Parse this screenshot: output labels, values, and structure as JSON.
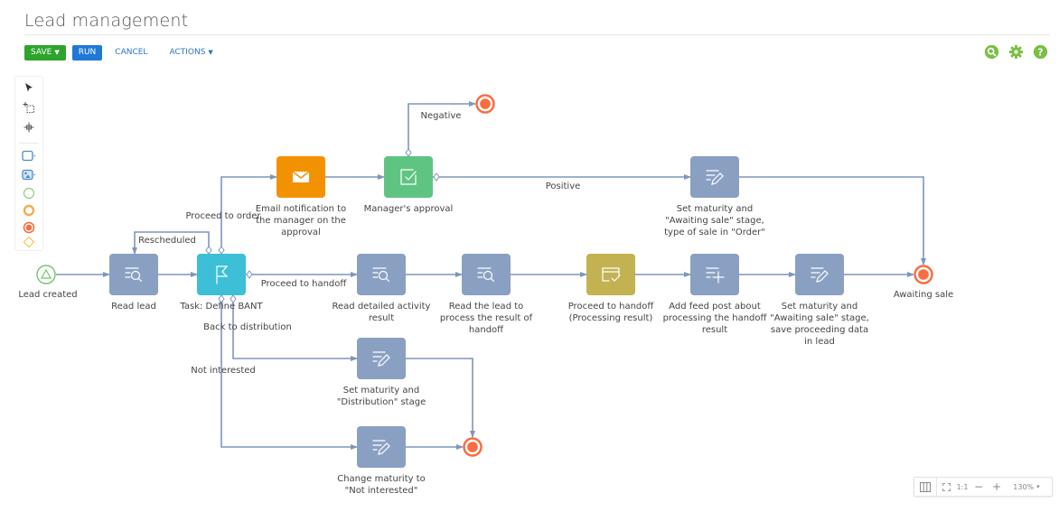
{
  "page": {
    "title": "Lead management"
  },
  "toolbar": {
    "save_label": "SAVE",
    "run_label": "RUN",
    "cancel_label": "CANCEL",
    "actions_label": "ACTIONS",
    "caret": "▼"
  },
  "top_icons": [
    "search-icon",
    "gear-icon",
    "help-icon"
  ],
  "palette": {
    "tools": [
      "pointer-tool",
      "marquee-select-tool",
      "move-tool"
    ],
    "elements": [
      "user-task-element",
      "script-task-element",
      "start-event-element",
      "intermediate-event-element",
      "end-event-element",
      "exclusive-gateway-element"
    ]
  },
  "colors": {
    "task": "#8aa0c3",
    "bant_task": "#3dbfd8",
    "email_task": "#f39200",
    "approval_task": "#5fc482",
    "handoff_task": "#c3b252",
    "flow": "#7f96bb",
    "end_event": "#f96c3f",
    "start_event": "#75c26b"
  },
  "nodes": {
    "lead_created": {
      "label": [
        "Lead created"
      ]
    },
    "read_lead": {
      "label": [
        "Read lead"
      ]
    },
    "define_bant": {
      "label": [
        "Task: Define BANT"
      ]
    },
    "email_notification": {
      "label": [
        "Email notification to",
        "the manager on the",
        "approval"
      ]
    },
    "manager_approval": {
      "label": [
        "Manager's approval"
      ]
    },
    "set_order": {
      "label": [
        "Set maturity and",
        "\"Awaiting sale\" stage,",
        "type of sale in \"Order\""
      ]
    },
    "read_activity": {
      "label": [
        "Read detailed activity",
        "result"
      ]
    },
    "read_lead_handoff": {
      "label": [
        "Read the lead to",
        "process the result of",
        "handoff"
      ]
    },
    "proceed_handoff": {
      "label": [
        "Proceed to handoff",
        "(Processing result)"
      ]
    },
    "add_feed_post": {
      "label": [
        "Add feed post about",
        "processing the handoff",
        "result"
      ]
    },
    "set_awaiting": {
      "label": [
        "Set maturity and",
        "\"Awaiting sale\" stage,",
        "save proceeding data",
        "in lead"
      ]
    },
    "awaiting_sale": {
      "label": [
        "Awaiting sale"
      ]
    },
    "set_distribution": {
      "label": [
        "Set maturity and",
        "\"Distribution\" stage"
      ]
    },
    "not_interested": {
      "label": [
        "Change maturity to",
        "\"Not interested\""
      ]
    }
  },
  "flows": {
    "negative": "Negative",
    "positive": "Positive",
    "proceed_to_order": "Proceed to order",
    "rescheduled": "Rescheduled",
    "proceed_to_handoff": "Proceed to handoff",
    "back_to_distribution": "Back to distribution",
    "not_interested": "Not interested"
  },
  "zoom_controls": {
    "fit_label": "1:1",
    "minus": "−",
    "plus": "+",
    "zoom_level": "130%",
    "caret": "▾"
  }
}
